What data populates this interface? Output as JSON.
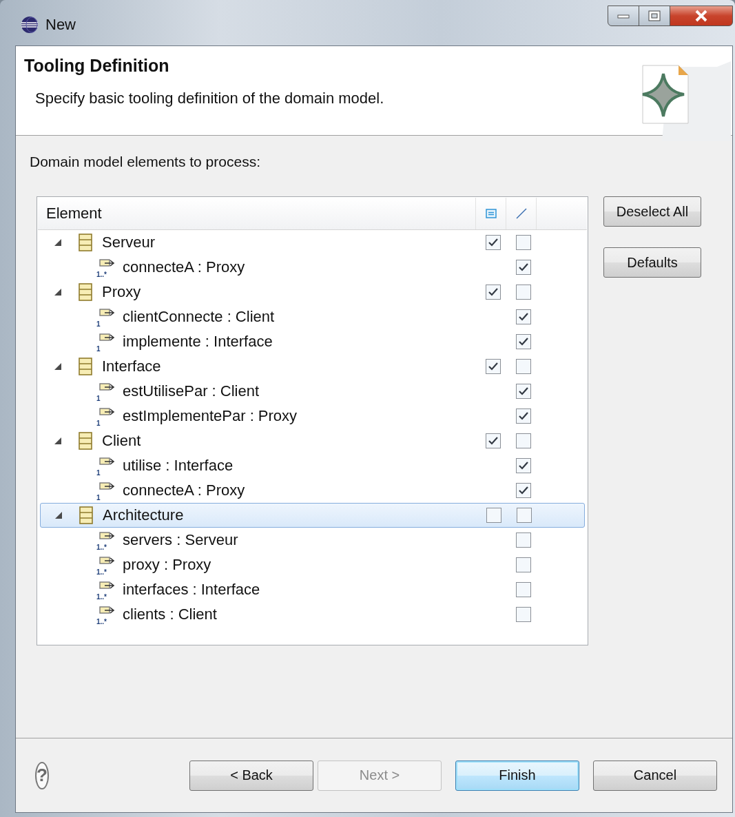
{
  "window": {
    "title": "New"
  },
  "header": {
    "title": "Tooling Definition",
    "description": "Specify basic tooling definition of the domain model."
  },
  "section_label": "Domain model elements to process:",
  "tree": {
    "column": "Element",
    "rows": [
      {
        "kind": "class",
        "label": "Serveur",
        "expanded": true,
        "selected": false,
        "node_checked": true,
        "link_checked": false,
        "children": [
          {
            "kind": "reference",
            "label": "connecteA : Proxy",
            "multiplicity": "1..*",
            "selected": false,
            "link_checked": true
          }
        ]
      },
      {
        "kind": "class",
        "label": "Proxy",
        "expanded": true,
        "selected": false,
        "node_checked": true,
        "link_checked": false,
        "children": [
          {
            "kind": "reference",
            "label": "clientConnecte : Client",
            "multiplicity": "1",
            "selected": false,
            "link_checked": true
          },
          {
            "kind": "reference",
            "label": "implemente : Interface",
            "multiplicity": "1",
            "selected": false,
            "link_checked": true
          }
        ]
      },
      {
        "kind": "class",
        "label": "Interface",
        "expanded": true,
        "selected": false,
        "node_checked": true,
        "link_checked": false,
        "children": [
          {
            "kind": "reference",
            "label": "estUtilisePar : Client",
            "multiplicity": "1",
            "selected": false,
            "link_checked": true
          },
          {
            "kind": "reference",
            "label": "estImplementePar : Proxy",
            "multiplicity": "1",
            "selected": false,
            "link_checked": true
          }
        ]
      },
      {
        "kind": "class",
        "label": "Client",
        "expanded": true,
        "selected": false,
        "node_checked": true,
        "link_checked": false,
        "children": [
          {
            "kind": "reference",
            "label": "utilise : Interface",
            "multiplicity": "1",
            "selected": false,
            "link_checked": true
          },
          {
            "kind": "reference",
            "label": "connecteA : Proxy",
            "multiplicity": "1",
            "selected": false,
            "link_checked": true
          }
        ]
      },
      {
        "kind": "class",
        "label": "Architecture",
        "expanded": true,
        "selected": true,
        "node_checked": false,
        "link_checked": false,
        "children": [
          {
            "kind": "reference",
            "label": "servers : Serveur",
            "multiplicity": "1..*",
            "selected": false,
            "link_checked": false
          },
          {
            "kind": "reference",
            "label": "proxy : Proxy",
            "multiplicity": "1..*",
            "selected": false,
            "link_checked": false
          },
          {
            "kind": "reference",
            "label": "interfaces : Interface",
            "multiplicity": "1..*",
            "selected": false,
            "link_checked": false
          },
          {
            "kind": "reference",
            "label": "clients : Client",
            "multiplicity": "1..*",
            "selected": false,
            "link_checked": false
          }
        ]
      }
    ]
  },
  "help_button": {
    "label": "?"
  },
  "side_buttons": [
    {
      "label": "Deselect All"
    },
    {
      "label": "Defaults"
    }
  ],
  "footer_buttons": [
    {
      "label": "< Back",
      "disabled": false,
      "default": false
    },
    {
      "label": "Next >",
      "disabled": true,
      "default": false
    },
    {
      "label": "Finish",
      "disabled": false,
      "default": true
    },
    {
      "label": "Cancel",
      "disabled": false,
      "default": false
    }
  ]
}
